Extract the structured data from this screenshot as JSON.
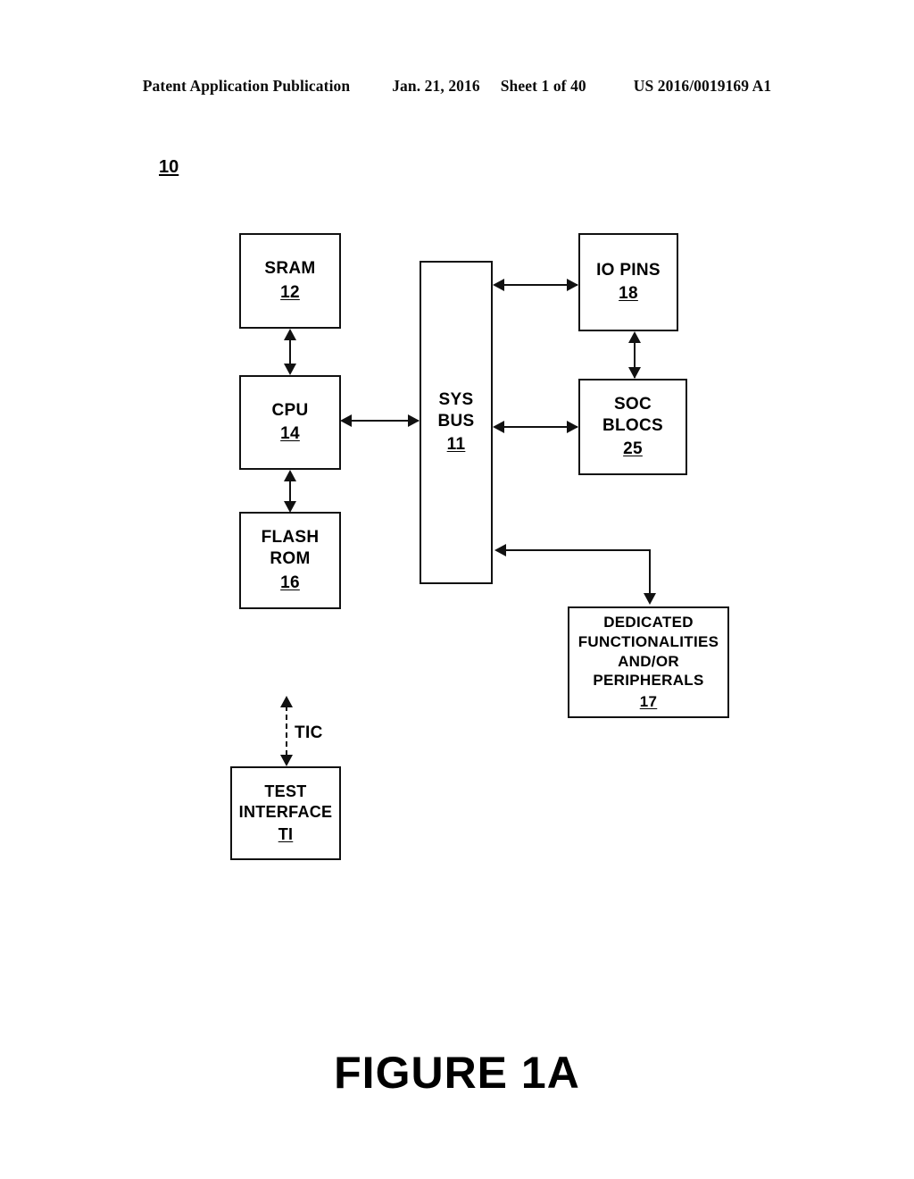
{
  "header": {
    "publication": "Patent Application Publication",
    "date": "Jan. 21, 2016",
    "sheet": "Sheet 1 of 40",
    "patent_number": "US 2016/0019169 A1"
  },
  "figure": {
    "system_ref": "10",
    "caption": "FIGURE 1A",
    "link_label_tic": "TIC"
  },
  "blocks": {
    "sram": {
      "line1": "SRAM",
      "num": "12"
    },
    "cpu": {
      "line1": "CPU",
      "num": "14"
    },
    "flash_rom": {
      "line1": "FLASH",
      "line2": "ROM",
      "num": "16"
    },
    "sys_bus": {
      "line1": "SYS",
      "line2": "BUS",
      "num": "11"
    },
    "io_pins": {
      "line1": "IO PINS",
      "num": "18"
    },
    "soc_blocs": {
      "line1": "SOC",
      "line2": "BLOCS",
      "num": "25"
    },
    "dedicated": {
      "line1": "DEDICATED",
      "line2": "FUNCTIONALITIES",
      "line3": "AND/OR",
      "line4": "PERIPHERALS",
      "num": "17"
    },
    "test_interface": {
      "line1": "TEST",
      "line2": "INTERFACE",
      "num": "TI"
    }
  },
  "connections": [
    {
      "from": "sram",
      "to": "cpu",
      "style": "solid",
      "heads": "both",
      "orientation": "vertical"
    },
    {
      "from": "cpu",
      "to": "flash_rom",
      "style": "solid",
      "heads": "both",
      "orientation": "vertical"
    },
    {
      "from": "cpu",
      "to": "sys_bus",
      "style": "solid",
      "heads": "both",
      "orientation": "horizontal"
    },
    {
      "from": "sys_bus",
      "to": "io_pins",
      "style": "solid",
      "heads": "both",
      "orientation": "horizontal"
    },
    {
      "from": "sys_bus",
      "to": "soc_blocs",
      "style": "solid",
      "heads": "both",
      "orientation": "horizontal"
    },
    {
      "from": "io_pins",
      "to": "soc_blocs",
      "style": "solid",
      "heads": "both",
      "orientation": "vertical"
    },
    {
      "from": "sys_bus",
      "to": "dedicated",
      "style": "solid",
      "heads": "both",
      "orientation": "elbow"
    },
    {
      "from": "test_interface",
      "to": "external",
      "style": "dashed",
      "heads": "both",
      "orientation": "vertical",
      "label": "TIC"
    }
  ],
  "colors": {
    "ink": "#111111",
    "page_background": "#ffffff"
  }
}
